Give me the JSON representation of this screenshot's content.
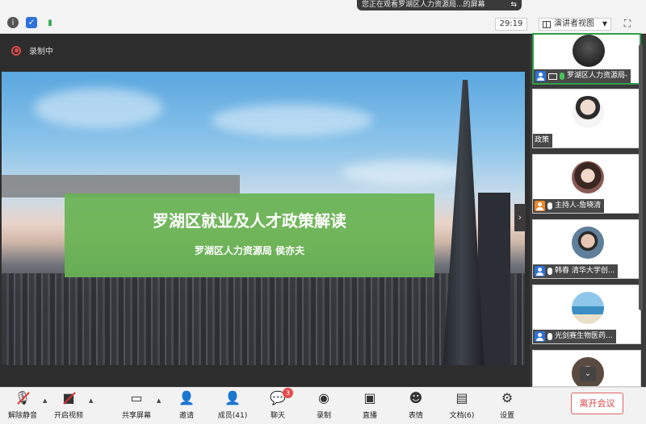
{
  "sharing_banner": "您正在观看罗湖区人力资源局...的屏幕",
  "timer": "29:19",
  "view_mode": "演讲者视图",
  "recording_label": "录制中",
  "slide": {
    "title": "罗湖区就业及人才政策解读",
    "subtitle": "罗湖区人力资源局 侯亦夫"
  },
  "participants": [
    {
      "label": "罗湖区人力资源局-",
      "role": "host-blue",
      "active": true
    },
    {
      "label": "政策",
      "role": "none"
    },
    {
      "label": "主持人-詹晓清",
      "role": "orange"
    },
    {
      "label": "韩春 清华大学创...",
      "role": "blue"
    },
    {
      "label": "光剑赛生物医药...",
      "role": "blue"
    }
  ],
  "toolbar": {
    "mute": "解除静音",
    "video": "开启视频",
    "share": "共享屏幕",
    "invite": "邀请",
    "members": "成员(41)",
    "chat": "聊天",
    "chat_badge": "3",
    "record": "录制",
    "live": "直播",
    "reactions": "表情",
    "docs": "文档(6)",
    "settings": "设置",
    "leave": "离开会议"
  },
  "colors": {
    "accent_green": "#68b454",
    "leave_red": "#d24343",
    "badge_red": "#e84a4a"
  }
}
